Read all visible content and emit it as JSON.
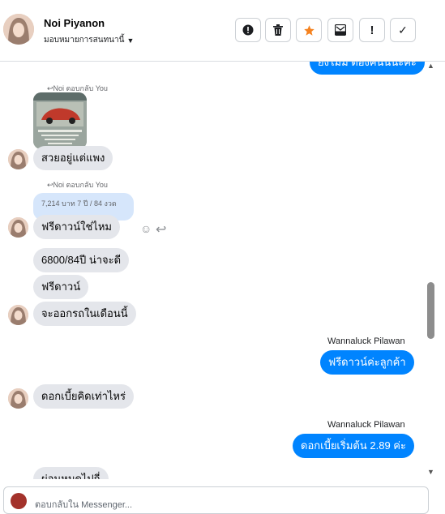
{
  "header": {
    "name": "Noi Piyanon",
    "assign_label": "มอบหมายการสนทนานี้",
    "toolbar": {
      "spam": "!",
      "done": "✓"
    }
  },
  "messages": {
    "top_outgoing": "ยังไม่มี ต้องคนนี้นะคะ",
    "reply1_tag": "Noi ตอบกลับ You",
    "msg1": "สวยอยู่แต่แพง",
    "reply2_tag": "Noi ตอบกลับ You",
    "quoted": "7,214 บาท 7 ปี / 84 งวด",
    "msg2": "ฟรีดาวน์ใช่ไหม",
    "msg3": "6800/84ปี   น่าจะดี",
    "msg4": "ฟรีดาวน์",
    "msg5": "จะออกรถในเดือนนี้",
    "sender1": "Wannaluck Pilawan",
    "out1": "ฟรีดาวน์ค่ะลูกค้า",
    "msg6": "ดอกเบี้ยคิดเท่าไหร่",
    "sender2": "Wannaluck Pilawan",
    "out2": "ดอกเบี้ยเริ่มต้น 2.89 ค่ะ",
    "msg7": "ผ่อนหมดไปกี่"
  },
  "composer": {
    "placeholder": "ตอบกลับใน Messenger..."
  }
}
